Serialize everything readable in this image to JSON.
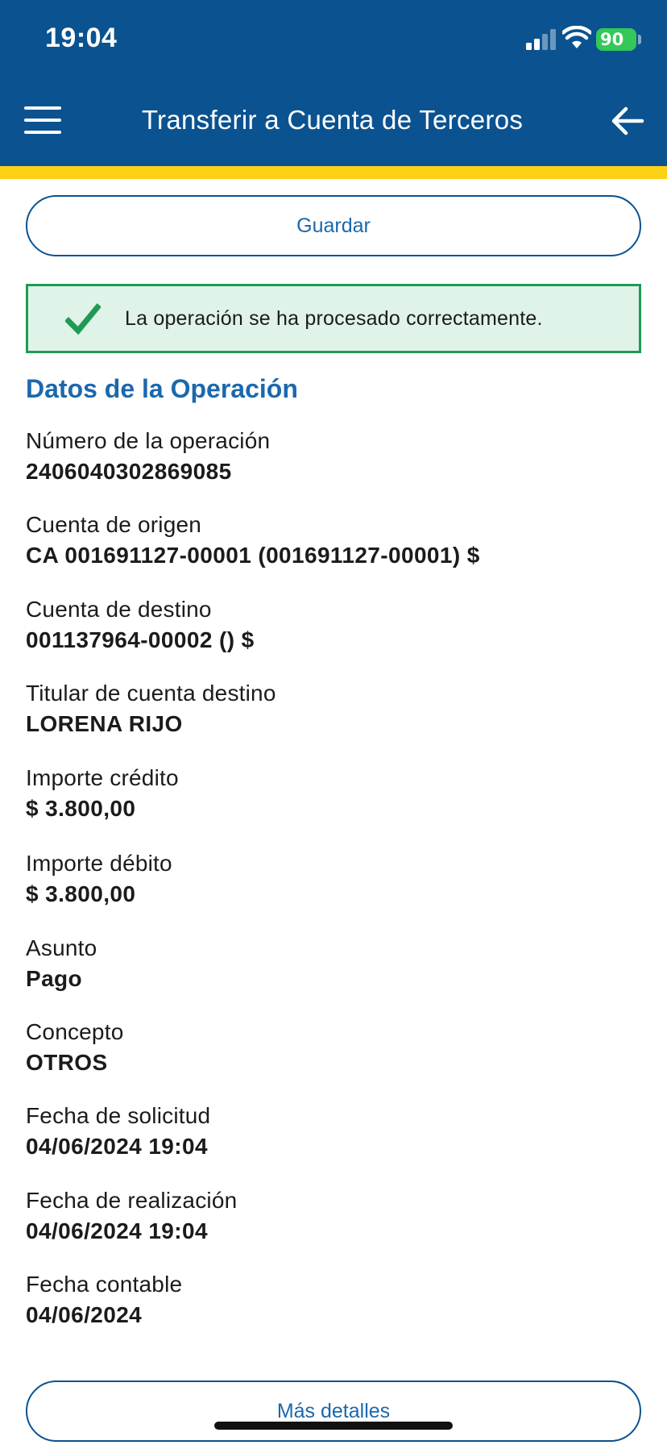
{
  "status_bar": {
    "time": "19:04",
    "battery": "90"
  },
  "header": {
    "title": "Transferir a Cuenta de Terceros"
  },
  "actions": {
    "save_label": "Guardar",
    "more_label": "Más detalles"
  },
  "alert": {
    "message": "La operación se ha procesado correctamente."
  },
  "section": {
    "title": "Datos de la Operación"
  },
  "fields": [
    {
      "label": "Número de la operación",
      "value": "2406040302869085"
    },
    {
      "label": "Cuenta de origen",
      "value": "CA 001691127-00001 (001691127-00001) $"
    },
    {
      "label": "Cuenta de destino",
      "value": "001137964-00002 () $"
    },
    {
      "label": "Titular de cuenta destino",
      "value": "LORENA RIJO"
    },
    {
      "label": "Importe crédito",
      "value": "$ 3.800,00"
    },
    {
      "label": "Importe débito",
      "value": "$ 3.800,00"
    },
    {
      "label": "Asunto",
      "value": "Pago"
    },
    {
      "label": "Concepto",
      "value": "OTROS"
    },
    {
      "label": "Fecha de solicitud",
      "value": "04/06/2024 19:04"
    },
    {
      "label": "Fecha de realización",
      "value": "04/06/2024 19:04"
    },
    {
      "label": "Fecha contable",
      "value": "04/06/2024"
    }
  ],
  "colors": {
    "header": "#0b5290",
    "accent": "#fcd116",
    "link": "#1c68ad",
    "success": "#1f9a55",
    "success_bg": "#dff3e8"
  },
  "icons": {
    "menu": "hamburger-menu-icon",
    "back": "arrow-left-icon",
    "success": "checkmark-icon",
    "signal": "cellular-signal-icon",
    "wifi": "wifi-icon",
    "battery": "battery-icon"
  }
}
